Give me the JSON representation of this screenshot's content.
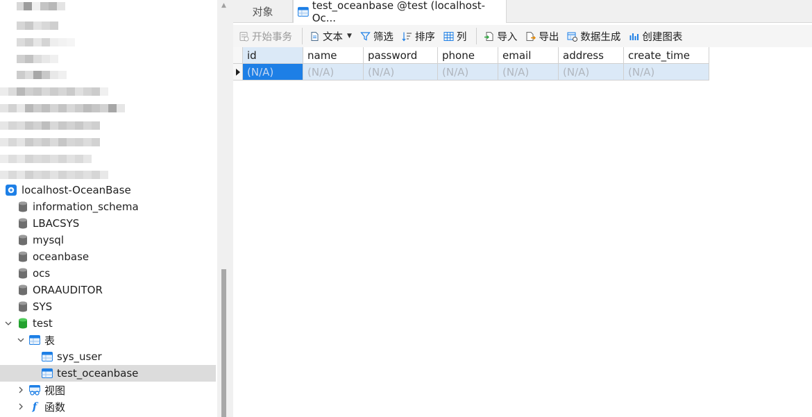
{
  "tree": {
    "connection": {
      "label": "localhost-OceanBase"
    },
    "databases": [
      {
        "label": "information_schema"
      },
      {
        "label": "LBACSYS"
      },
      {
        "label": "mysql"
      },
      {
        "label": "oceanbase"
      },
      {
        "label": "ocs"
      },
      {
        "label": "ORAAUDITOR"
      },
      {
        "label": "SYS"
      },
      {
        "label": "test"
      }
    ],
    "tables_node": {
      "label": "表"
    },
    "tables": [
      {
        "label": "sys_user"
      },
      {
        "label": "test_oceanbase"
      }
    ],
    "views_node": {
      "label": "视图"
    },
    "functions_node": {
      "label": "函数"
    }
  },
  "tabs": {
    "objects": "对象",
    "active": "test_oceanbase @test (localhost-Oc..."
  },
  "toolbar": {
    "begin_transaction": "开始事务",
    "text": "文本",
    "filter": "筛选",
    "sort": "排序",
    "columns": "列",
    "import": "导入",
    "export": "导出",
    "data_generation": "数据生成",
    "create_chart": "创建图表"
  },
  "grid": {
    "columns": [
      "id",
      "name",
      "password",
      "phone",
      "email",
      "address",
      "create_time"
    ],
    "rows": [
      [
        "(N/A)",
        "(N/A)",
        "(N/A)",
        "(N/A)",
        "(N/A)",
        "(N/A)",
        "(N/A)"
      ]
    ]
  },
  "colors": {
    "accent": "#1d7fe6",
    "selected_row": "#dbe9f7",
    "tree_selection": "#dcdcdc",
    "db_green": "#2eb82e"
  }
}
